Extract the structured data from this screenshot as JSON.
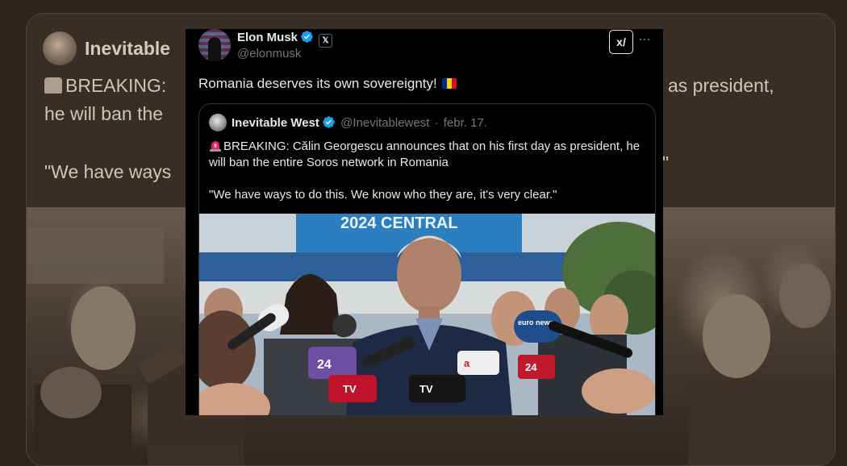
{
  "background_card": {
    "name": "Inevitable",
    "line1": "BREAKING:",
    "line1_right": "as president,",
    "line2": "he will ban the",
    "line3": "\"We have ways"
  },
  "tweet": {
    "author_name": "Elon Musk",
    "author_handle": "@elonmusk",
    "text": "Romania deserves its own sovereignty!",
    "grok_icon_label": "x/",
    "more_label": "···",
    "x_badge": "𝕏"
  },
  "quote": {
    "author_name": "Inevitable West",
    "author_handle": "@Inevitablewest",
    "separator": "·",
    "date": "febr. 17.",
    "breaking_text": "BREAKING: Călin Georgescu announces that on his first day as president, he will ban the entire Soros network in Romania",
    "quote_text": "\"We have ways to do this. We know who they are, it's very clear.\""
  },
  "photo": {
    "banner_text": "2024 CENTRAL",
    "mic_labels": [
      "TV",
      "24",
      "a",
      "euro news",
      "24",
      "TV"
    ]
  },
  "colors": {
    "verified": "#1d9bf0",
    "text_primary": "#e7e9ea",
    "text_secondary": "#71767b",
    "tweet_bg": "#000000",
    "sepia_bg": "#2d241e"
  },
  "icons": [
    "verified-badge-icon",
    "x-logo-icon",
    "grok-icon",
    "more-icon",
    "siren-icon",
    "romania-flag-icon"
  ]
}
